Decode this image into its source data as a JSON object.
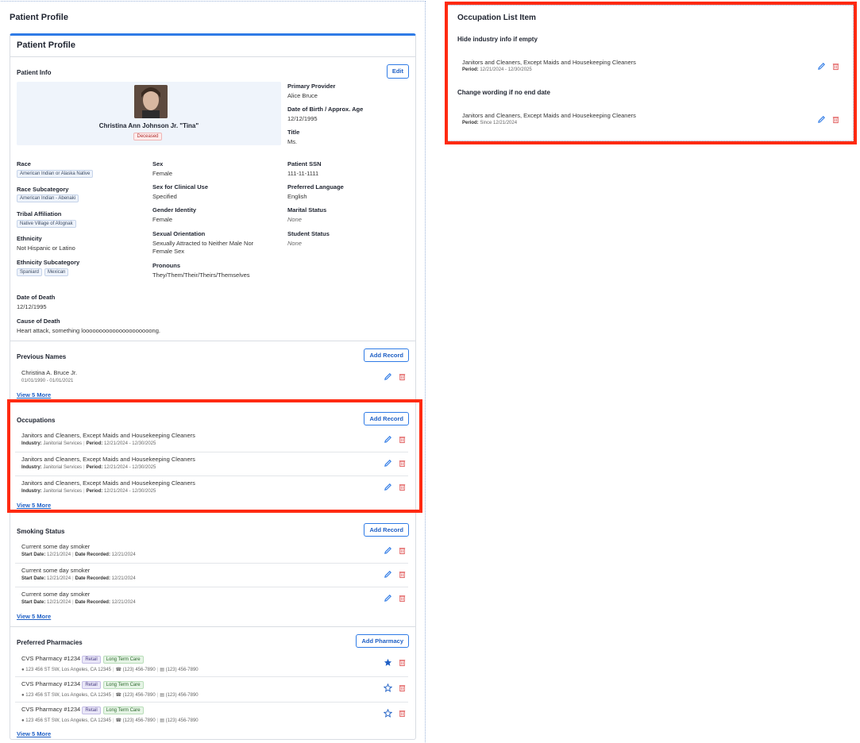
{
  "page": {
    "title": "Patient Profile"
  },
  "card": {
    "title": "Patient Profile"
  },
  "patient_info": {
    "title": "Patient Info",
    "edit_label": "Edit",
    "name": "Christina Ann Johnson Jr. \"Tina\"",
    "status_badge": "Deceased",
    "primary_provider": {
      "label": "Primary Provider",
      "value": "Alice Bruce"
    },
    "dob": {
      "label": "Date of Birth / Approx. Age",
      "value": "12/12/1995"
    },
    "title_field": {
      "label": "Title",
      "value": "Ms."
    },
    "race": {
      "label": "Race",
      "chips": [
        "American Indian or Alaska Native"
      ]
    },
    "race_subcategory": {
      "label": "Race Subcategory",
      "chips": [
        "American Indian - Abenaki"
      ]
    },
    "tribal_affiliation": {
      "label": "Tribal Affiliation",
      "chips": [
        "Native Village of Afognak"
      ]
    },
    "ethnicity": {
      "label": "Ethnicity",
      "value": "Not Hispanic or Latino"
    },
    "ethnicity_subcategory": {
      "label": "Ethnicity Subcategory",
      "chips": [
        "Spaniard",
        "Mexican"
      ]
    },
    "sex": {
      "label": "Sex",
      "value": "Female"
    },
    "sex_clinical": {
      "label": "Sex for Clinical Use",
      "value": "Specified"
    },
    "gender_identity": {
      "label": "Gender Identity",
      "value": "Female"
    },
    "sexual_orientation": {
      "label": "Sexual Orientation",
      "value_line1": "Sexually Attracted to Neither Male Nor",
      "value_line2": "Female Sex"
    },
    "pronouns": {
      "label": "Pronouns",
      "value": "They/Them/Their/Theirs/Themselves"
    },
    "ssn": {
      "label": "Patient SSN",
      "value": "111-11-1111"
    },
    "language": {
      "label": "Preferred Language",
      "value": "English"
    },
    "marital": {
      "label": "Marital Status",
      "value": "None"
    },
    "student": {
      "label": "Student Status",
      "value": "None"
    },
    "date_of_death": {
      "label": "Date of Death",
      "value": "12/12/1995"
    },
    "cause_of_death": {
      "label": "Cause of Death",
      "value": "Heart attack, something looooooooooooooooooooong."
    }
  },
  "previous_names": {
    "title": "Previous Names",
    "button": "Add Record",
    "items": [
      {
        "name": "Christina A. Bruce Jr.",
        "dates": "01/01/1990 - 01/01/2021"
      }
    ],
    "more": "View 5 More"
  },
  "occupations": {
    "title": "Occupations",
    "button": "Add Record",
    "industry_label": "Industry:",
    "period_label": "Period:",
    "items": [
      {
        "title": "Janitors and Cleaners, Except Maids and Housekeeping Cleaners",
        "industry": "Janitorial Services",
        "period": "12/21/2024 - 12/30/2025"
      },
      {
        "title": "Janitors and Cleaners, Except Maids and Housekeeping Cleaners",
        "industry": "Janitorial Services",
        "period": "12/21/2024 - 12/30/2025"
      },
      {
        "title": "Janitors and Cleaners, Except Maids and Housekeeping Cleaners",
        "industry": "Janitorial Services",
        "period": "12/21/2024 - 12/30/2025"
      }
    ],
    "more": "View 5 More"
  },
  "smoking": {
    "title": "Smoking Status",
    "button": "Add Record",
    "start_label": "Start Date:",
    "recorded_label": "Date Recorded:",
    "items": [
      {
        "title": "Current some day smoker",
        "start": "12/21/2024",
        "recorded": "12/21/2024"
      },
      {
        "title": "Current some day smoker",
        "start": "12/21/2024",
        "recorded": "12/21/2024"
      },
      {
        "title": "Current some day smoker",
        "start": "12/21/2024",
        "recorded": "12/21/2024"
      }
    ],
    "more": "View 5 More"
  },
  "pharmacies": {
    "title": "Preferred Pharmacies",
    "button": "Add Pharmacy",
    "items": [
      {
        "name": "CVS Pharmacy #1234",
        "tag1": "Retail",
        "tag2": "Long Term Care",
        "address": "123 456 ST SW, Los Angeles, CA 12345",
        "phone": "(123) 456-7890",
        "fax": "(123) 456-7890",
        "preferred": true
      },
      {
        "name": "CVS Pharmacy #1234",
        "tag1": "Retail",
        "tag2": "Long Term Care",
        "address": "123 456 ST SW, Los Angeles, CA 12345",
        "phone": "(123) 456-7890",
        "fax": "(123) 456-7890",
        "preferred": false
      },
      {
        "name": "CVS Pharmacy #1234",
        "tag1": "Retail",
        "tag2": "Long Term Care",
        "address": "123 456 ST SW, Los Angeles, CA 12345",
        "phone": "(123) 456-7890",
        "fax": "(123) 456-7890",
        "preferred": false
      }
    ],
    "more": "View 5 More"
  },
  "occupation_list_item": {
    "title": "Occupation List Item",
    "case1": {
      "label": "Hide industry info if empty",
      "title": "Janitors and Cleaners, Except Maids and Housekeeping Cleaners",
      "period_label": "Period:",
      "period": "12/21/2024 - 12/30/2025"
    },
    "case2": {
      "label": "Change wording if no end date",
      "title": "Janitors and Cleaners, Except Maids and Housekeeping Cleaners",
      "period_label": "Period:",
      "period": "Since 12/21/2024"
    }
  },
  "colors": {
    "accent": "#2f7be6",
    "highlight": "#ff2a10",
    "danger": "#e05555"
  },
  "icons": [
    "pencil-icon",
    "trash-icon",
    "star-icon",
    "phone-icon",
    "fax-icon",
    "pin-icon"
  ]
}
